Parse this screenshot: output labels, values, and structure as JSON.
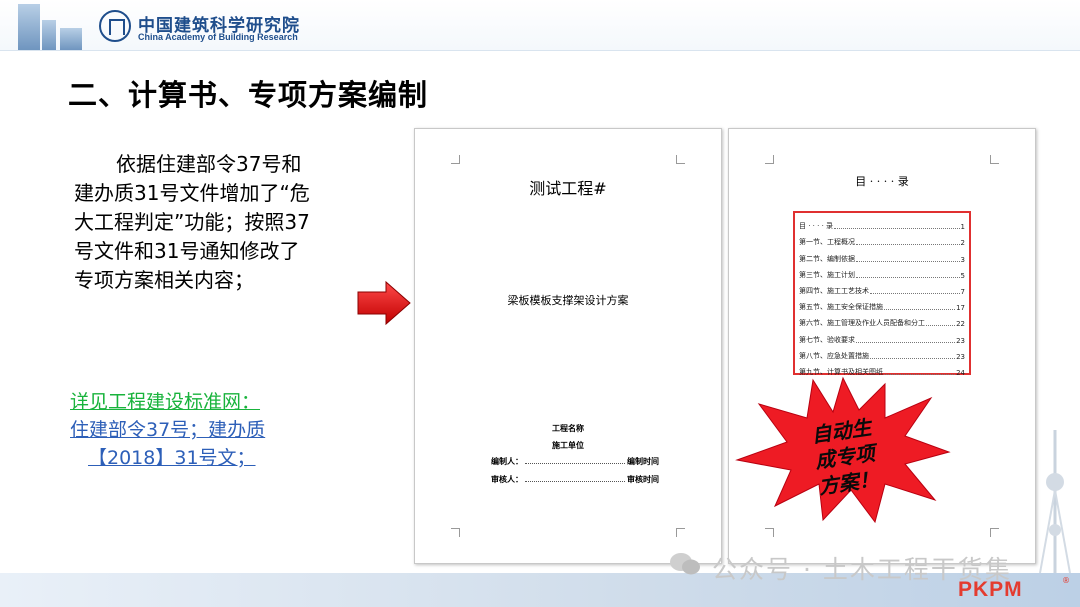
{
  "header": {
    "org_name_cn": "中国建筑科学研究院",
    "org_name_en": "China Academy of Building Research"
  },
  "slide": {
    "title": "二、计算书、专项方案编制",
    "paragraph": "依据住建部令37号和建办质31号文件增加了“危大工程判定”功能；按照37号文件和31号通知修改了专项方案相关内容；",
    "link_line1": "详见工程建设标准网：",
    "link_line2": "住建部令37号；建办质",
    "link_line3": "【2018】31号文；"
  },
  "doc_cover": {
    "title": "测试工程#",
    "subtitle": "梁板模板支撑架设计方案",
    "project_name_label": "工程名称",
    "construction_unit_label": "施工单位",
    "compiler_label": "编制人：",
    "compile_time_label": "编制时间",
    "reviewer_label": "审核人：",
    "review_time_label": "审核时间"
  },
  "doc_toc": {
    "title": "目 · · · · 录",
    "entries": [
      {
        "label": "目 · · · · 录",
        "page": "1"
      },
      {
        "label": "第一节、工程概况",
        "page": "2"
      },
      {
        "label": "第二节、编制依据",
        "page": "3"
      },
      {
        "label": "第三节、施工计划",
        "page": "5"
      },
      {
        "label": "第四节、施工工艺技术",
        "page": "7"
      },
      {
        "label": "第五节、施工安全保证措施",
        "page": "17"
      },
      {
        "label": "第六节、施工管理及作业人员配备和分工",
        "page": "22"
      },
      {
        "label": "第七节、验收要求",
        "page": "23"
      },
      {
        "label": "第八节、应急处置措施",
        "page": "23"
      },
      {
        "label": "第九节、计算书及相关图纸",
        "page": "24"
      }
    ]
  },
  "callout": {
    "line1": "自动生",
    "line2": "成专项",
    "line3": "方案！",
    "color": "#ee1b24"
  },
  "footer": {
    "watermark": "公众号 · 土木工程干货集",
    "brand": "PKPM",
    "registered": "®"
  }
}
